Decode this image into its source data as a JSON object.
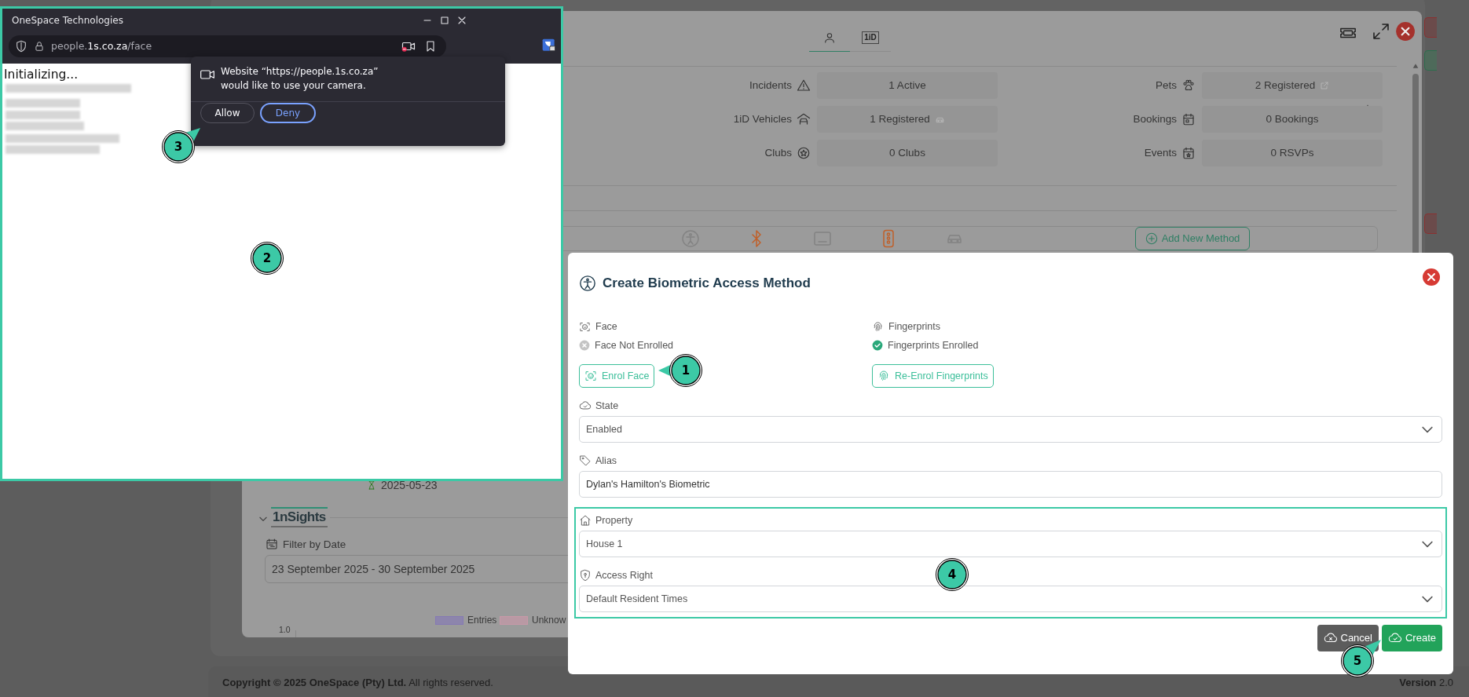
{
  "footer": {
    "copyright": "**Copyright © 2025 OneSpace (Pty) Ltd.** All rights reserved.",
    "version": "**Version** 2.0"
  },
  "profile_panel": {
    "tabs": [
      {
        "selected": true
      },
      {
        "label": "1iD",
        "selected": false
      }
    ],
    "info": [
      {
        "label": "Incidents",
        "value": "1 Active"
      },
      {
        "label": "Pets",
        "value": "2 Registered"
      },
      {
        "label": "1iD Vehicles",
        "value": "1 Registered"
      },
      {
        "label": "Bookings",
        "value": "0 Bookings"
      },
      {
        "label": "Clubs",
        "value": "0 Clubs"
      },
      {
        "label": "Events",
        "value": "0 RSVPs"
      }
    ],
    "access_methods": [
      {
        "active": false
      },
      {
        "active": true
      },
      {
        "active": false
      },
      {
        "active": true
      },
      {
        "active": false
      }
    ],
    "add_method_button": "Add New Method",
    "expiry_date": "2025-05-23",
    "insights": {
      "logo": "1nSights",
      "filter_label": "Filter by Date",
      "date_range": "23 September 2025 - 30 September 2025",
      "legend": [
        {
          "name": "Entries",
          "color": "#8579b4"
        },
        {
          "name": "Unknow",
          "color": "#c898a8"
        }
      ],
      "y_tick": "1.0"
    }
  },
  "browser_popup": {
    "title": "OneSpace Technologies",
    "url": "people.**1s.co.za**/face",
    "highlighted": true,
    "status": "Initializing...",
    "permission": {
      "message": [
        "Website “https://people.1s.co.za”",
        "would like to use your camera."
      ],
      "buttons": [
        {
          "label": "Allow",
          "kind": "secondary"
        },
        {
          "label": "Deny",
          "kind": "primary"
        }
      ]
    }
  },
  "create_modal": {
    "title": "Create Biometric Access Method",
    "methods": [
      {
        "label": "Face",
        "status": "Face Not Enrolled",
        "enrolled": false,
        "button": "Enrol Face"
      },
      {
        "label": "Fingerprints",
        "status": "Fingerprints Enrolled",
        "enrolled": true,
        "button": "Re-Enrol Fingerprints"
      }
    ],
    "fields": [
      {
        "label": "State",
        "kind": "select",
        "value": "Enabled",
        "highlighted": false
      },
      {
        "label": "Alias",
        "kind": "text",
        "value": "Dylan's Hamilton's Biometric",
        "highlighted": false
      },
      {
        "label": "Property",
        "kind": "select",
        "value": "House 1",
        "highlighted": true
      },
      {
        "label": "Access Right",
        "kind": "select",
        "value": "Default Resident Times",
        "highlighted": true
      }
    ],
    "buttons": [
      {
        "label": "Cancel",
        "kind": "secondary"
      },
      {
        "label": "Create",
        "kind": "primary"
      }
    ]
  },
  "markers": [
    {
      "label": "1"
    },
    {
      "label": "2"
    },
    {
      "label": "3"
    },
    {
      "label": "4"
    },
    {
      "label": "5"
    }
  ]
}
